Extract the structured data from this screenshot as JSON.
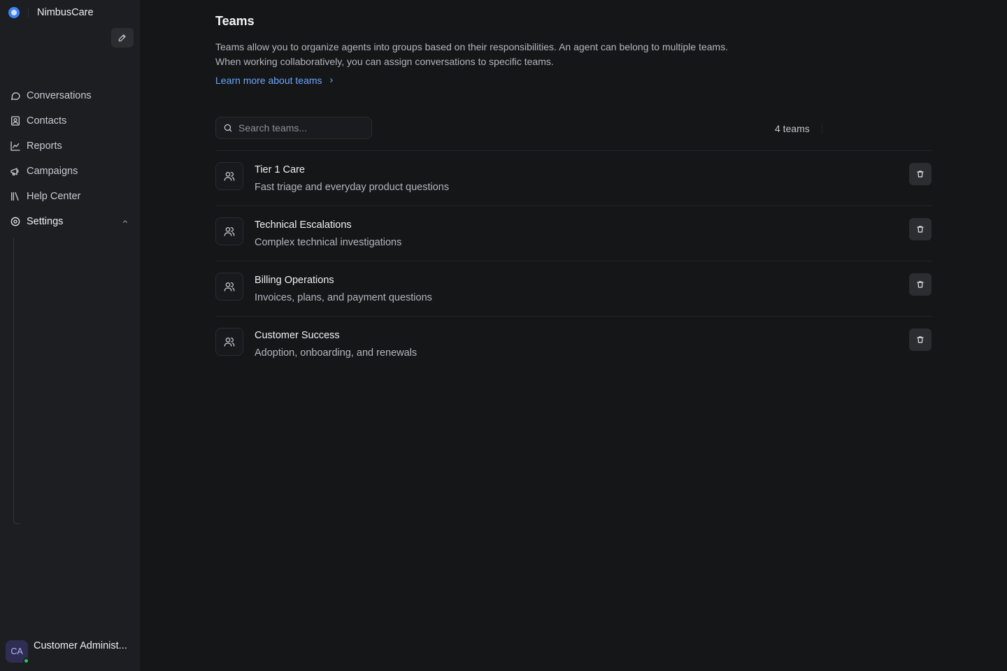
{
  "app": {
    "name": "NimbusCare"
  },
  "sidebar": {
    "items": [
      {
        "label": "Conversations",
        "icon": "chat-bubble-icon"
      },
      {
        "label": "Contacts",
        "icon": "contact-card-icon"
      },
      {
        "label": "Reports",
        "icon": "line-chart-icon"
      },
      {
        "label": "Campaigns",
        "icon": "megaphone-icon"
      },
      {
        "label": "Help Center",
        "icon": "library-icon"
      },
      {
        "label": "Settings",
        "icon": "gear-icon"
      }
    ]
  },
  "user": {
    "initials": "CA",
    "name": "Customer Administ...",
    "status_color": "#22c55e"
  },
  "page": {
    "title": "Teams",
    "description_line1": "Teams allow you to organize agents into groups based on their responsibilities. An agent can belong to multiple teams.",
    "description_line2": "When working collaboratively, you can assign conversations to specific teams.",
    "learn_more": "Learn more about teams"
  },
  "search": {
    "placeholder": "Search teams...",
    "value": ""
  },
  "count_label": "4 teams",
  "teams": [
    {
      "name": "Tier 1 Care",
      "description": "Fast triage and everyday product questions"
    },
    {
      "name": "Technical Escalations",
      "description": "Complex technical investigations"
    },
    {
      "name": "Billing Operations",
      "description": "Invoices, plans, and payment questions"
    },
    {
      "name": "Customer Success",
      "description": "Adoption, onboarding, and renewals"
    }
  ],
  "colors": {
    "accent": "#6aa8ff",
    "brand": "#3b82f6",
    "background": "#151618",
    "sidebar": "#1d1e21"
  }
}
